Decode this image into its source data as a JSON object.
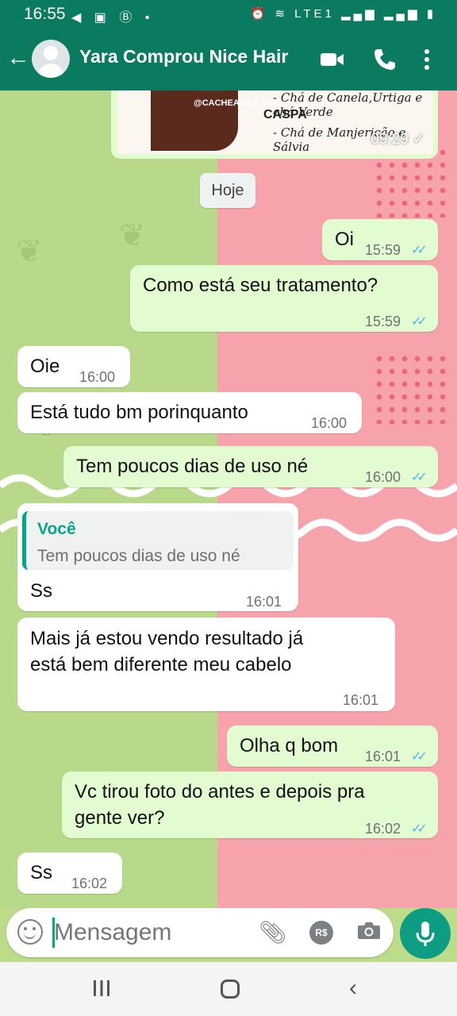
{
  "status_bar": {
    "time": "16:55",
    "left_icons": "◀ ▣ Ⓑ •",
    "right_icons": "⏰ ≋ LTE1 ▂▄▆ ▂▄▆ ▮"
  },
  "header": {
    "back_icon": "arrow-left-icon",
    "contact_name": "Yara Comprou Nice Hair"
  },
  "image_message": {
    "handle": "@CACHEADAS_PODEROSASS_",
    "line1": "- Chá de Canela,Urtiga e chá Verde",
    "line2": "CASPA",
    "line3": "- Chá de Manjericão e Sálvia",
    "time": "09:29 ✓"
  },
  "date_chip": "Hoje",
  "messages": [
    {
      "dir": "out",
      "text": "Oi",
      "time": "15:59"
    },
    {
      "dir": "out",
      "text": "Como está seu tratamento?",
      "time": "15:59"
    },
    {
      "dir": "in",
      "text": "Oie",
      "time": "16:00"
    },
    {
      "dir": "in",
      "text": "Está tudo bm porinquanto",
      "time": "16:00"
    },
    {
      "dir": "out",
      "text": "Tem poucos dias de uso né",
      "time": "16:00"
    },
    {
      "dir": "in",
      "quote_name": "Você",
      "quote_text": "Tem poucos dias de uso né",
      "text": "Ss",
      "time": "16:01"
    },
    {
      "dir": "in",
      "text_line1": "Mais já estou vendo resultado já",
      "text_line2": "está bem diferente meu cabelo",
      "time": "16:01"
    },
    {
      "dir": "out",
      "text": "Olha q bom",
      "time": "16:01"
    },
    {
      "dir": "out",
      "text_line1": "Vc tirou foto do antes e depois pra",
      "text_line2": "gente ver?",
      "time": "16:02"
    },
    {
      "dir": "in",
      "text": "Ss",
      "time": "16:02"
    }
  ],
  "composer": {
    "placeholder": "Mensagem",
    "money_label": "R$"
  },
  "colors": {
    "header": "#0a7a60",
    "outgoing": "#e3fbd0",
    "incoming": "#ffffff",
    "ticks": "#4fb6ec",
    "accent": "#07a587"
  }
}
